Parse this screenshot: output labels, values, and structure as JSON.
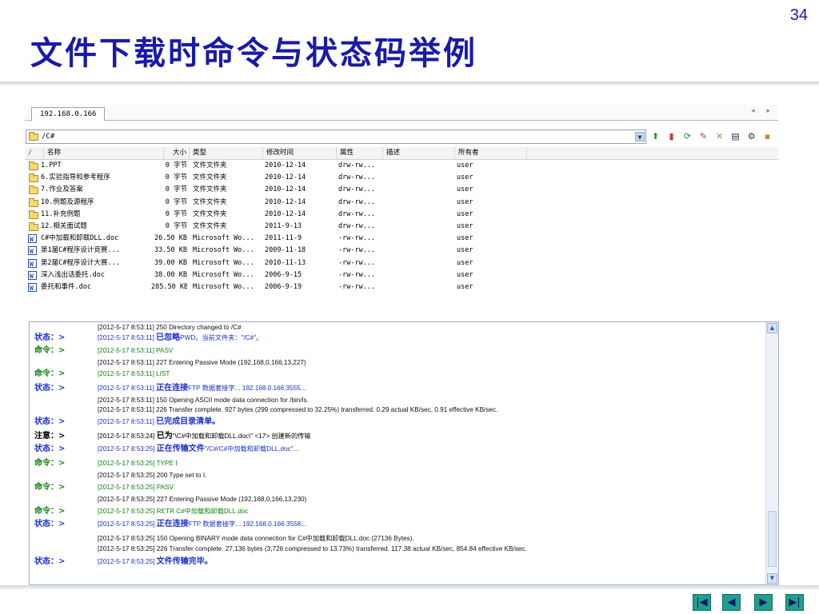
{
  "slide": {
    "title": "文件下载时命令与状态码举例",
    "page_number": "34"
  },
  "app": {
    "tab_label": "192.168.0.166",
    "tab_arrows": "◂ ▸",
    "path": "/C#",
    "columns": [
      "名称",
      "大小",
      "类型",
      "修改时间",
      "属性",
      "描述",
      "所有者"
    ],
    "files": [
      {
        "name": "1.PPT",
        "size": "0 字节",
        "type": "文件文件夹",
        "modified": "2010-12-14",
        "attr": "drw-rw...",
        "desc": "",
        "owner": "user",
        "icon": "folder-icon"
      },
      {
        "name": "6.实验指导和参考程序",
        "size": "0 字节",
        "type": "文件文件夹",
        "modified": "2010-12-14",
        "attr": "drw-rw...",
        "desc": "",
        "owner": "user",
        "icon": "folder-icon"
      },
      {
        "name": "7.作业及答案",
        "size": "0 字节",
        "type": "文件文件夹",
        "modified": "2010-12-14",
        "attr": "drw-rw...",
        "desc": "",
        "owner": "user",
        "icon": "folder-icon"
      },
      {
        "name": "10.例题及源程序",
        "size": "0 字节",
        "type": "文件文件夹",
        "modified": "2010-12-14",
        "attr": "drw-rw...",
        "desc": "",
        "owner": "user",
        "icon": "folder-icon"
      },
      {
        "name": "11.补充例题",
        "size": "0 字节",
        "type": "文件文件夹",
        "modified": "2010-12-14",
        "attr": "drw-rw...",
        "desc": "",
        "owner": "user",
        "icon": "folder-icon"
      },
      {
        "name": "12.相关面试题",
        "size": "0 字节",
        "type": "文件文件夹",
        "modified": "2011-9-13",
        "attr": "drw-rw...",
        "desc": "",
        "owner": "user",
        "icon": "folder-icon"
      },
      {
        "name": "C#中加载和卸载DLL.doc",
        "size": "26.50 KB",
        "type": "Microsoft Wo...",
        "modified": "2011-11-9",
        "attr": "-rw-rw...",
        "desc": "",
        "owner": "user",
        "icon": "word-doc-icon"
      },
      {
        "name": "第1届C#程序设计竞赛...",
        "size": "33.50 KB",
        "type": "Microsoft Wo...",
        "modified": "2009-11-18",
        "attr": "-rw-rw...",
        "desc": "",
        "owner": "user",
        "icon": "word-doc-icon"
      },
      {
        "name": "第2届C#程序设计大赛...",
        "size": "39.00 KB",
        "type": "Microsoft Wo...",
        "modified": "2010-11-13",
        "attr": "-rw-rw...",
        "desc": "",
        "owner": "user",
        "icon": "word-doc-icon"
      },
      {
        "name": "深入浅出话委托.doc",
        "size": "38.00 KB",
        "type": "Microsoft Wo...",
        "modified": "2006-9-15",
        "attr": "-rw-rw...",
        "desc": "",
        "owner": "user",
        "icon": "word-doc-icon"
      },
      {
        "name": "委托和事件.doc",
        "size": "285.50 KB",
        "type": "Microsoft Wo...",
        "modified": "2006-9-19",
        "attr": "-rw-rw...",
        "desc": "",
        "owner": "user",
        "icon": "word-doc-icon"
      }
    ]
  },
  "log": [
    {
      "label": "",
      "kind": "resp",
      "pre": "[2012-5-17 8:53:11] 250 Directory changed to /C#",
      "bold": "",
      "post": ""
    },
    {
      "label": "状态：>",
      "kind": "status",
      "pre": "[2012-5-17 8:53:11] ",
      "bold": "已忽略",
      "post": "PWD。当前文件夹：\"/C#\"。"
    },
    {
      "label": "命令：>",
      "kind": "cmd",
      "pre": "[2012-5-17 8:53:11] PASV",
      "bold": "",
      "post": ""
    },
    {
      "label": "",
      "kind": "resp",
      "pre": "[2012-5-17 8:53:11] 227 Entering Passive Mode (192,168,0,166,13,227)",
      "bold": "",
      "post": ""
    },
    {
      "label": "命令：>",
      "kind": "cmd",
      "pre": "[2012-5-17 8:53:11] LIST",
      "bold": "",
      "post": ""
    },
    {
      "label": "状态：>",
      "kind": "status",
      "pre": "[2012-5-17 8:53:11] ",
      "bold": "正在连接",
      "post": "FTP 数据套接字... 192.168.0.166:3555..."
    },
    {
      "label": "",
      "kind": "resp",
      "pre": "[2012-5-17 8:53:11] 150 Opening ASCII mode data connection for /bin/ls.",
      "bold": "",
      "post": ""
    },
    {
      "label": "",
      "kind": "resp",
      "pre": "[2012-5-17 8:53:11] 226 Transfer complete. 927 bytes (299 compressed to 32.25%) transferred. 0.29 actual KB/sec,  0.91 effective KB/sec.",
      "bold": "",
      "post": ""
    },
    {
      "label": "状态：>",
      "kind": "status",
      "pre": "[2012-5-17 8:53:11] ",
      "bold": "已完成目录清单。",
      "post": ""
    },
    {
      "label": "注意：>",
      "kind": "note",
      "pre": "[2012-5-17 8:53:24] ",
      "bold": "已为",
      "post": "\"\\C#中加载和卸载DLL.doc\\\" <17> 创建新的传输"
    },
    {
      "label": "状态：>",
      "kind": "status",
      "pre": "[2012-5-17 8:53:25] ",
      "bold": "正在传输文件",
      "post": "\"/C#/C#中加载和卸载DLL.doc\"..."
    },
    {
      "label": "命令：>",
      "kind": "cmd",
      "pre": "[2012-5-17 8:53:25] TYPE I",
      "bold": "",
      "post": ""
    },
    {
      "label": "",
      "kind": "resp",
      "pre": "[2012-5-17 8:53:25] 200 Type set to I.",
      "bold": "",
      "post": ""
    },
    {
      "label": "命令：>",
      "kind": "cmd",
      "pre": "[2012-5-17 8:53:25] PASV",
      "bold": "",
      "post": ""
    },
    {
      "label": "",
      "kind": "resp",
      "pre": "[2012-5-17 8:53:25] 227 Entering Passive Mode (192,168,0,166,13,230)",
      "bold": "",
      "post": ""
    },
    {
      "label": "命令：>",
      "kind": "cmd",
      "pre": "[2012-5-17 8:53:25] RETR C#中加载和卸载DLL.doc",
      "bold": "",
      "post": ""
    },
    {
      "label": "状态：>",
      "kind": "status",
      "pre": "[2012-5-17 8:53:25] ",
      "bold": "正在连接",
      "post": "FTP 数据套接字... 192.168.0.166:3558..."
    },
    {
      "label": "",
      "kind": "resp",
      "pre": "[2012-5-17 8:53:25] 150 Opening BINARY mode data connection for C#中加载和卸载DLL.doc (27136 Bytes).",
      "bold": "",
      "post": ""
    },
    {
      "label": "",
      "kind": "resp",
      "pre": "[2012-5-17 8:53:25] 226 Transfer complete. 27,136 bytes (3,726 compressed to 13.73%) transferred. 117.38 actual KB/sec,  854.84 effective KB/sec.",
      "bold": "",
      "post": ""
    },
    {
      "label": "状态：>",
      "kind": "status",
      "pre": "[2012-5-17 8:53:25] ",
      "bold": "文件传输完毕。",
      "post": ""
    }
  ],
  "nav_buttons": [
    {
      "name": "first-slide-button",
      "glyph": "|◀"
    },
    {
      "name": "previous-slide-button",
      "glyph": "◀"
    },
    {
      "name": "next-slide-button",
      "glyph": "▶"
    },
    {
      "name": "last-slide-button",
      "glyph": "▶|"
    }
  ],
  "colors": {
    "title": "#1a1aa8",
    "status": "#1a2fd0",
    "command": "#108010",
    "nav": "#1fa08d"
  }
}
